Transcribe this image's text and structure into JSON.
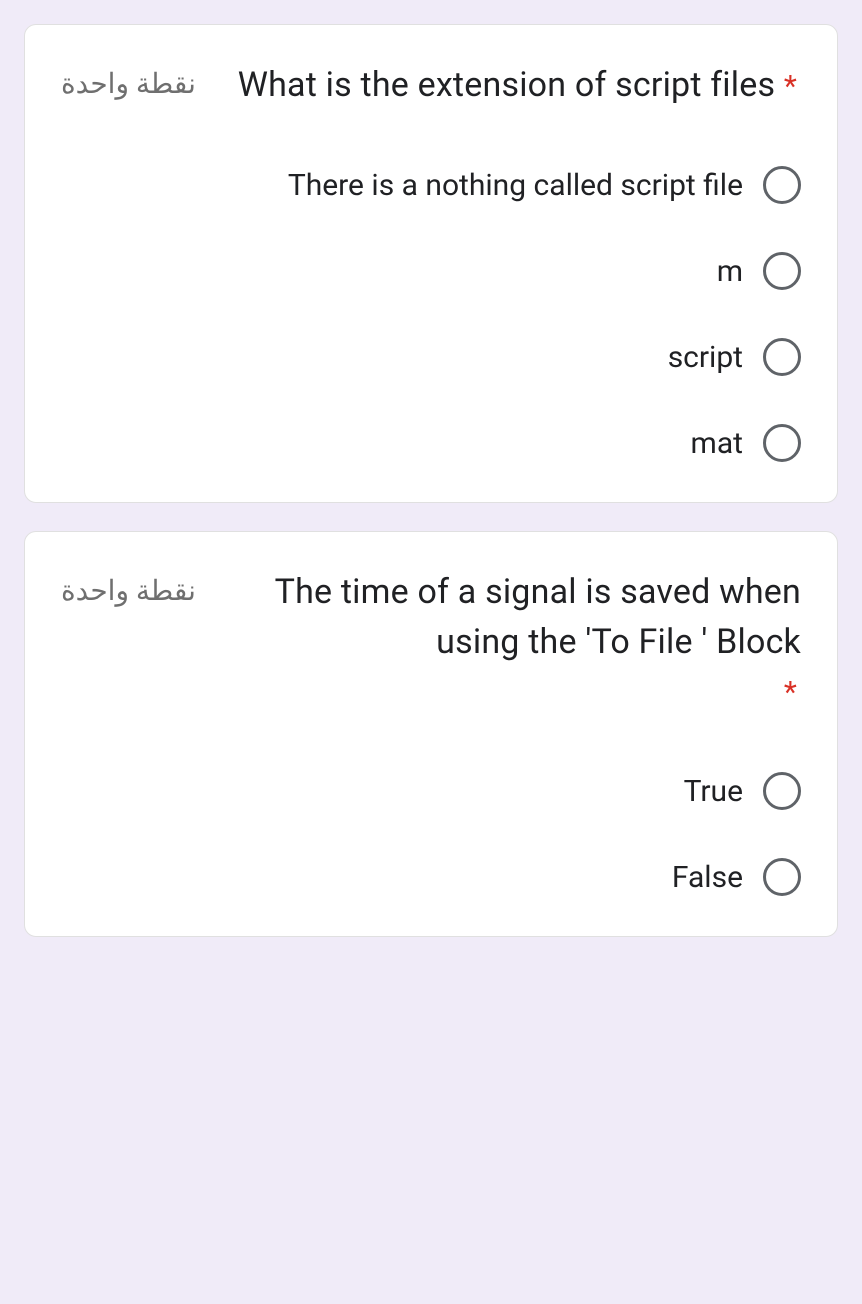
{
  "questions": [
    {
      "points_label": "نقطة واحدة",
      "text": "What is the extension of script files",
      "required_mark": "*",
      "options": [
        {
          "label": "There is a nothing called script file"
        },
        {
          "label": "m"
        },
        {
          "label": "script"
        },
        {
          "label": "mat"
        }
      ]
    },
    {
      "points_label": "نقطة واحدة",
      "text": "The time of a signal is saved when using the 'To File ' Block",
      "required_mark": "*",
      "options": [
        {
          "label": "True"
        },
        {
          "label": "False"
        }
      ]
    }
  ]
}
